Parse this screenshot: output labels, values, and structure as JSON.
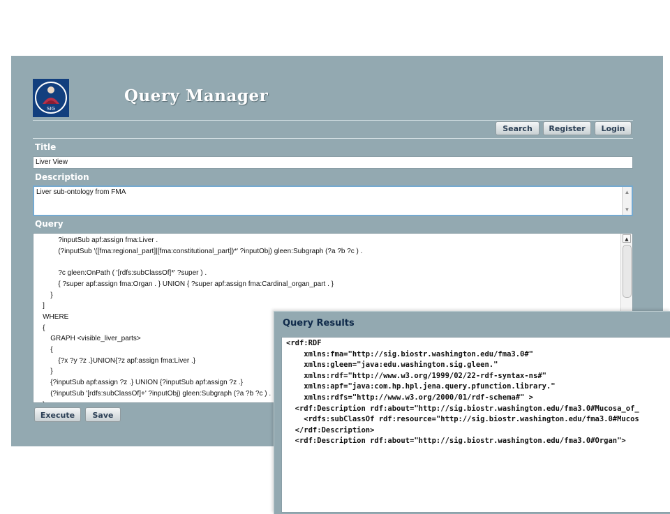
{
  "app": {
    "title": "Query Manager",
    "logo_text": "SIG"
  },
  "nav": {
    "search_label": "Search",
    "register_label": "Register",
    "login_label": "Login"
  },
  "form": {
    "title_label": "Title",
    "title_value": "Liver View",
    "description_label": "Description",
    "description_value": "Liver sub-ontology from FMA",
    "query_label": "Query",
    "query_text": "            ?inputSub apf:assign fma:Liver .\n            (?inputSub '([fma:regional_part]|[fma:constitutional_part])*' ?inputObj) gleen:Subgraph (?a ?b ?c ) .\n\n            ?c gleen:OnPath ( '[rdfs:subClassOf]*' ?super ) .\n            { ?super apf:assign fma:Organ . } UNION { ?super apf:assign fma:Cardinal_organ_part . }\n        }\n    ]\n    WHERE\n    {\n        GRAPH <visible_liver_parts>\n        {\n            {?x ?y ?z .}UNION{?z apf:assign fma:Liver .}\n        }\n        {?inputSub apf:assign ?z .} UNION {?inputSub apf:assign ?z .}\n        (?inputSub '[rdfs:subClassOf]+' ?inputObj) gleen:Subgraph (?a ?b ?c ) .\n    }\n]",
    "execute_label": "Execute",
    "save_label": "Save"
  },
  "results": {
    "title": "Query Results",
    "text": "<rdf:RDF\n    xmlns:fma=\"http://sig.biostr.washington.edu/fma3.0#\"\n    xmlns:gleen=\"java:edu.washington.sig.gleen.\"\n    xmlns:rdf=\"http://www.w3.org/1999/02/22-rdf-syntax-ns#\"\n    xmlns:apf=\"java:com.hp.hpl.jena.query.pfunction.library.\"\n    xmlns:rdfs=\"http://www.w3.org/2000/01/rdf-schema#\" >\n  <rdf:Description rdf:about=\"http://sig.biostr.washington.edu/fma3.0#Mucosa_of_\n    <rdfs:subClassOf rdf:resource=\"http://sig.biostr.washington.edu/fma3.0#Mucos\n  </rdf:Description>\n  <rdf:Description rdf:about=\"http://sig.biostr.washington.edu/fma3.0#Organ\">"
  },
  "colors": {
    "panel_bg": "#93a9b1",
    "logo_bg": "#123f7e",
    "focus_border": "#74a9d0"
  }
}
